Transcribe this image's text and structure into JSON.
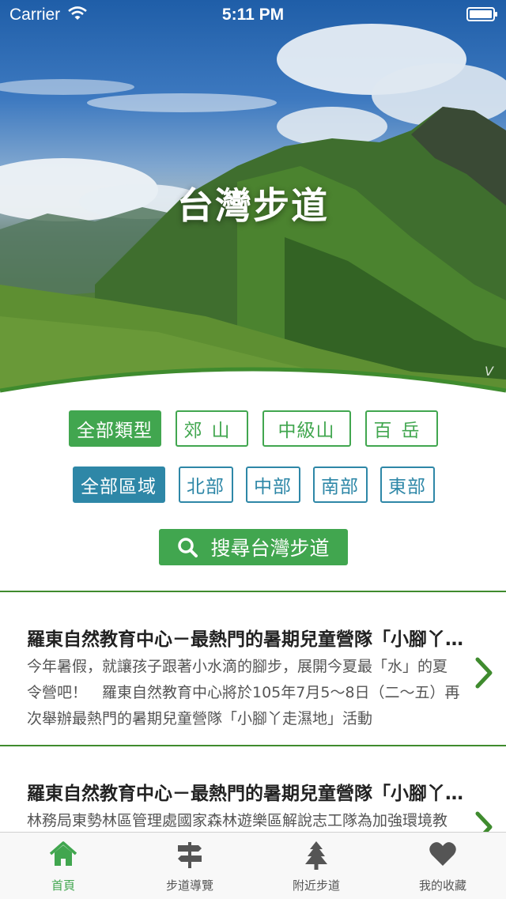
{
  "status_bar": {
    "carrier": "Carrier",
    "time": "5:11 PM"
  },
  "hero": {
    "title": "台灣步道",
    "credit": "V"
  },
  "filters": {
    "types": [
      {
        "label": "全部類型",
        "active": true
      },
      {
        "label": "郊山",
        "active": false
      },
      {
        "label": "中級山",
        "active": false
      },
      {
        "label": "百岳",
        "active": false
      }
    ],
    "regions": [
      {
        "label": "全部區域",
        "active": true
      },
      {
        "label": "北部",
        "active": false
      },
      {
        "label": "中部",
        "active": false
      },
      {
        "label": "南部",
        "active": false
      },
      {
        "label": "東部",
        "active": false
      }
    ]
  },
  "search": {
    "label": "搜尋台灣步道"
  },
  "articles": [
    {
      "title": "羅東自然教育中心－最熱門的暑期兒童營隊「小腳丫走濕地」",
      "desc": "今年暑假，就讓孩子跟著小水滴的腳步，展開今夏最「水」的夏令營吧！　羅東自然教育中心將於105年7月5～8日（二～五）再次舉辦最熱門的暑期兒童營隊「小腳丫走濕地」活動"
    },
    {
      "title": "羅東自然教育中心－最熱門的暑期兒童營隊「小腳丫走濕地」",
      "desc": "林務局東勢林區管理處國家森林遊樂區解說志工隊為加強環境教育"
    }
  ],
  "tabs": [
    {
      "label": "首頁",
      "icon": "home-icon",
      "active": true
    },
    {
      "label": "步道導覽",
      "icon": "signpost-icon",
      "active": false
    },
    {
      "label": "附近步道",
      "icon": "tree-icon",
      "active": false
    },
    {
      "label": "我的收藏",
      "icon": "heart-icon",
      "active": false
    }
  ],
  "colors": {
    "green": "#41a64f",
    "teal": "#2e87a7",
    "divider": "#3f8b2e"
  }
}
